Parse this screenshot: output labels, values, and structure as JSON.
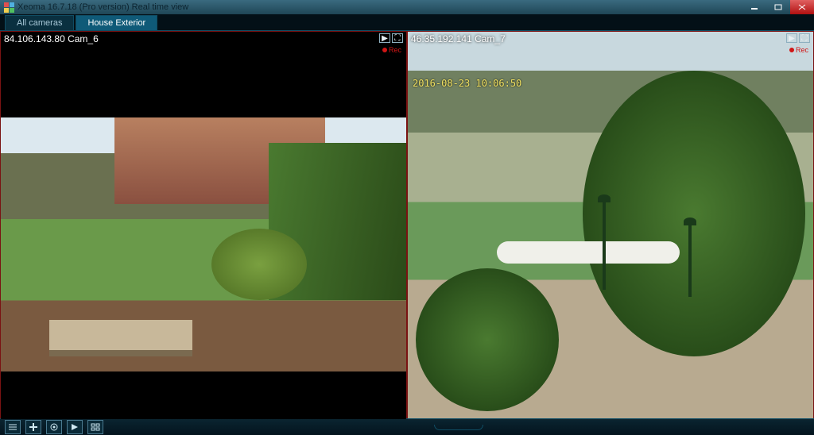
{
  "window": {
    "title": "Xeoma 16.7.18 (Pro version) Real time view"
  },
  "tabs": {
    "items": [
      {
        "label": "All cameras",
        "active": false
      },
      {
        "label": "House Exterior",
        "active": true
      }
    ]
  },
  "cameras": [
    {
      "label": "84.106.143.80 Cam_6",
      "rec_label": "Rec",
      "overlay_timestamp": ""
    },
    {
      "label": "46.35.192.141 Cam_7",
      "rec_label": "Rec",
      "overlay_timestamp": "2016-08-23 10:06:50"
    }
  ],
  "icons": {
    "play": "play-icon",
    "fullscreen": "fullscreen-icon",
    "list": "list-icon",
    "add": "add-icon",
    "gear": "gear-icon",
    "playback": "playback-icon",
    "grid": "grid-icon",
    "minimize": "minimize-icon",
    "maximize": "maximize-icon",
    "close": "close-icon"
  }
}
